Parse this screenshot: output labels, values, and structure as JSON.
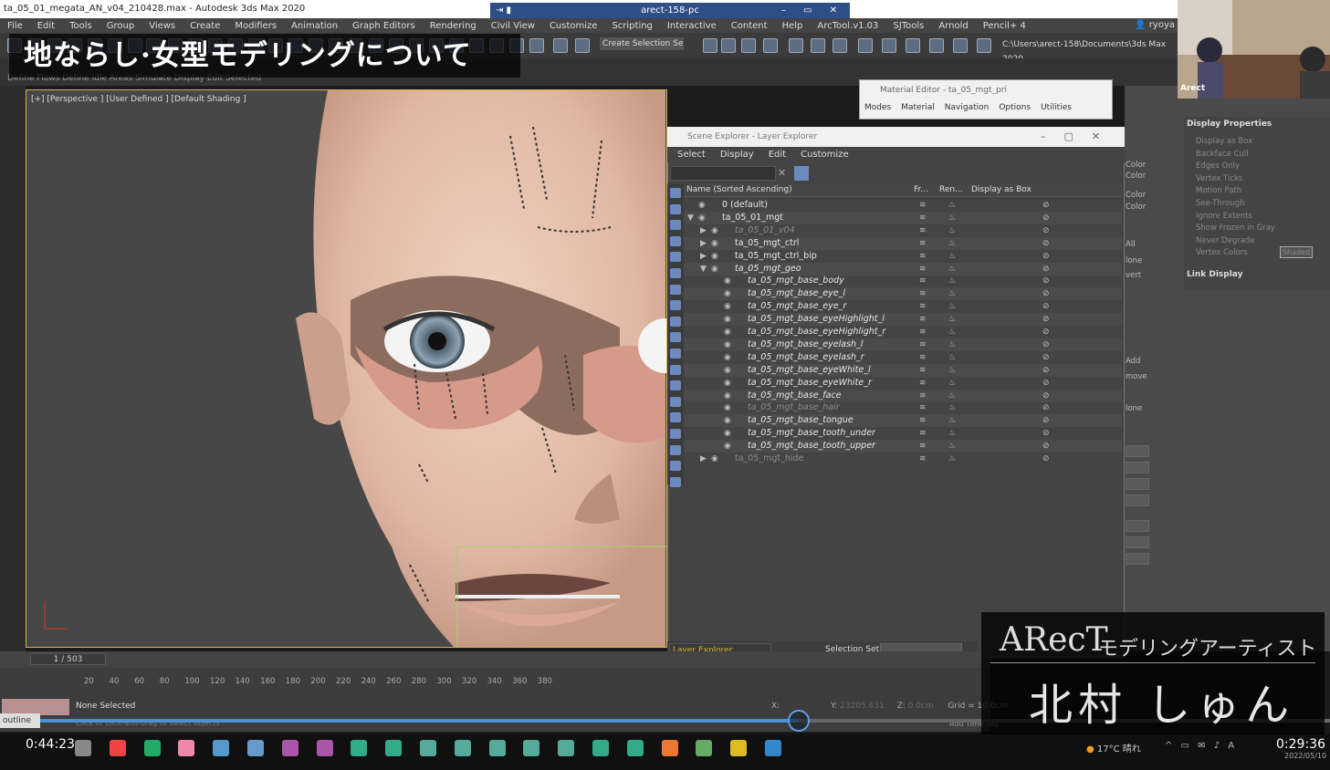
{
  "window": {
    "title": "ta_05_01_megata_AN_v04_210428.max - Autodesk 3ds Max 2020",
    "remote": "arect-158-pc",
    "remote_controls": "– ▭ ✕"
  },
  "menu": [
    "File",
    "Edit",
    "Tools",
    "Group",
    "Views",
    "Create",
    "Modifiers",
    "Animation",
    "Graph Editors",
    "Rendering",
    "Civil View",
    "Customize",
    "Scripting",
    "Interactive",
    "Content",
    "Help",
    "ArcTool.v1.03",
    "SJTools",
    "Arnold",
    "Pencil+ 4"
  ],
  "user": "ryoya nonaka",
  "toolbar": {
    "selection_set": "Create Selection Se",
    "path": "C:\\Users\\arect-158\\Documents\\3ds Max 2020"
  },
  "ribbon": {
    "text": "Define Flows  Define Idle Areas  Simulate  Display  Edit Selected"
  },
  "banner": "地ならし·女型モデリングについて",
  "viewport": {
    "label": "[+] [Perspective ] [User Defined ] [Default Shading ]"
  },
  "material_editor": {
    "title": "Material Editor - ta_05_mgt_pri",
    "menus": [
      "Modes",
      "Material",
      "Navigation",
      "Options",
      "Utilities"
    ]
  },
  "scene_explorer": {
    "title": "Scene Explorer - Layer Explorer",
    "menus": [
      "Select",
      "Display",
      "Edit",
      "Customize"
    ],
    "columns": [
      "Name (Sorted Ascending)",
      "Fr...",
      "Ren...",
      "Display as Box"
    ],
    "rows": [
      {
        "name": "0 (default)",
        "indent": 1,
        "italic": false,
        "dim": false
      },
      {
        "name": "ta_05_01_mgt",
        "indent": 1,
        "italic": false,
        "dim": false
      },
      {
        "name": "ta_05_01_v04",
        "indent": 2,
        "italic": true,
        "dim": true
      },
      {
        "name": "ta_05_mgt_ctrl",
        "indent": 2,
        "italic": false,
        "dim": false
      },
      {
        "name": "ta_05_mgt_ctrl_bip",
        "indent": 2,
        "italic": false,
        "dim": false
      },
      {
        "name": "ta_05_mgt_geo",
        "indent": 2,
        "italic": true,
        "dim": false
      },
      {
        "name": "ta_05_mgt_base_body",
        "indent": 3,
        "italic": true,
        "dim": false
      },
      {
        "name": "ta_05_mgt_base_eye_l",
        "indent": 3,
        "italic": true,
        "dim": false
      },
      {
        "name": "ta_05_mgt_base_eye_r",
        "indent": 3,
        "italic": true,
        "dim": false
      },
      {
        "name": "ta_05_mgt_base_eyeHighlight_l",
        "indent": 3,
        "italic": true,
        "dim": false
      },
      {
        "name": "ta_05_mgt_base_eyeHighlight_r",
        "indent": 3,
        "italic": true,
        "dim": false
      },
      {
        "name": "ta_05_mgt_base_eyelash_l",
        "indent": 3,
        "italic": true,
        "dim": false
      },
      {
        "name": "ta_05_mgt_base_eyelash_r",
        "indent": 3,
        "italic": true,
        "dim": false
      },
      {
        "name": "ta_05_mgt_base_eyeWhite_l",
        "indent": 3,
        "italic": true,
        "dim": false
      },
      {
        "name": "ta_05_mgt_base_eyeWhite_r",
        "indent": 3,
        "italic": true,
        "dim": false
      },
      {
        "name": "ta_05_mgt_base_face",
        "indent": 3,
        "italic": true,
        "dim": false
      },
      {
        "name": "ta_05_mgt_base_hair",
        "indent": 3,
        "italic": true,
        "dim": true
      },
      {
        "name": "ta_05_mgt_base_tongue",
        "indent": 3,
        "italic": true,
        "dim": false
      },
      {
        "name": "ta_05_mgt_base_tooth_under",
        "indent": 3,
        "italic": true,
        "dim": false
      },
      {
        "name": "ta_05_mgt_base_tooth_upper",
        "indent": 3,
        "italic": true,
        "dim": false
      },
      {
        "name": "ta_05_mgt_hide",
        "indent": 2,
        "italic": false,
        "dim": true
      }
    ],
    "footer": {
      "layer_dropdown": "Layer Explorer",
      "selection_set_label": "Selection Set:"
    }
  },
  "right_panel": {
    "display_properties": "Display Properties",
    "link_display": "Link Display",
    "props": [
      "Display as Box",
      "Backface Cull",
      "Edges Only",
      "Vertex Ticks",
      "Motion Path",
      "See-Through",
      "Ignore Extents",
      "Show Frozen in Gray",
      "Never Degrade",
      "Vertex Colors"
    ],
    "shaded": "Shaded",
    "labels": [
      "Color",
      "Color",
      "Color",
      "Color",
      "All",
      "lone",
      "vert",
      "Add",
      "move",
      "lone"
    ]
  },
  "timeline": {
    "frame_counter": "1 / 503",
    "ticks": [
      "20",
      "40",
      "60",
      "80",
      "100",
      "120",
      "140",
      "160",
      "180",
      "200",
      "220",
      "240",
      "260",
      "280",
      "300",
      "320",
      "340",
      "360",
      "380"
    ]
  },
  "status": {
    "selected": "None Selected",
    "hint": "Click or click-and-drag to select objects",
    "x": "X:",
    "y": "Y:",
    "z": "Z:",
    "y_value": "23205.631",
    "z_value": "0.0cm",
    "grid": "Grid = 10.0cm",
    "add_time_tag": "Add Time Tag"
  },
  "video": {
    "elapsed": "0:44:23",
    "remaining": "0:29:36",
    "outline_label": "outline"
  },
  "taskbar": {
    "weather": "17°C 晴れ",
    "date": "2022/05/10"
  },
  "camera_label": "Arect",
  "credit": {
    "company": "ARecT",
    "role": "モデリングアーティスト",
    "name": "北村 しゅん"
  },
  "colors": {
    "accent": "#d9b24a",
    "playbar": "#4a90d9",
    "layer_dropdown_text": "#e0b030"
  }
}
